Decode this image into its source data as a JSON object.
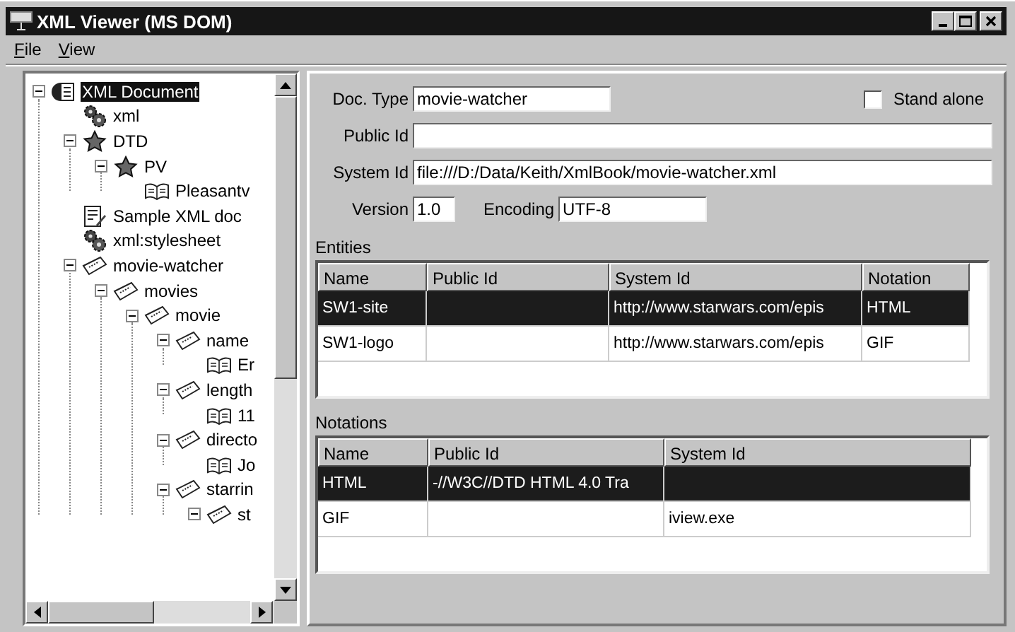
{
  "window": {
    "title": "XML Viewer (MS DOM)"
  },
  "menu": [
    {
      "label": "File"
    },
    {
      "label": "View"
    }
  ],
  "tree": [
    {
      "label": "XML Document",
      "kind": "document",
      "expanded": true,
      "selected": true,
      "children": [
        {
          "label": "xml",
          "kind": "instruction",
          "selected": false
        },
        {
          "label": "DTD",
          "kind": "declaration",
          "expanded": true,
          "selected": false,
          "children": [
            {
              "label": "PV",
              "kind": "declaration",
              "expanded": true,
              "selected": false,
              "children": [
                {
                  "label": "Pleasantv",
                  "kind": "text",
                  "selected": false
                }
              ]
            }
          ]
        },
        {
          "label": "Sample XML doc",
          "kind": "comment",
          "selected": false
        },
        {
          "label": "xml:stylesheet",
          "kind": "instruction",
          "selected": false
        },
        {
          "label": "movie-watcher",
          "kind": "element",
          "expanded": true,
          "selected": false,
          "children": [
            {
              "label": "movies",
              "kind": "element",
              "expanded": true,
              "selected": false,
              "children": [
                {
                  "label": "movie",
                  "kind": "element",
                  "expanded": true,
                  "selected": false,
                  "children": [
                    {
                      "label": "name",
                      "kind": "element",
                      "expanded": true,
                      "selected": false,
                      "children": [
                        {
                          "label": "Er",
                          "kind": "text",
                          "selected": false
                        }
                      ]
                    },
                    {
                      "label": "length",
                      "kind": "element",
                      "expanded": true,
                      "selected": false,
                      "children": [
                        {
                          "label": "11",
                          "kind": "text",
                          "selected": false
                        }
                      ]
                    },
                    {
                      "label": "directo",
                      "kind": "element",
                      "expanded": true,
                      "selected": false,
                      "children": [
                        {
                          "label": "Jo",
                          "kind": "text",
                          "selected": false
                        }
                      ]
                    },
                    {
                      "label": "starrin",
                      "kind": "element",
                      "expanded": true,
                      "selected": false,
                      "children": [
                        {
                          "label": "st",
                          "kind": "element",
                          "expanded": true,
                          "selected": false
                        }
                      ]
                    }
                  ]
                }
              ]
            }
          ]
        }
      ]
    }
  ],
  "document": {
    "doc_type": {
      "label": "Doc. Type",
      "value": "movie-watcher"
    },
    "standalone": {
      "label": "Stand alone",
      "checked": false
    },
    "public_id": {
      "label": "Public Id"
    },
    "system_id": {
      "label": "System Id",
      "value": "file:///D:/Data/Keith/XmlBook/movie-watcher.xml"
    },
    "version": {
      "label": "Version",
      "value": "1.0"
    },
    "encoding": {
      "label": "Encoding",
      "value": "UTF-8"
    }
  },
  "entities": {
    "label": "Entities",
    "columns": [
      "Name",
      "Public Id",
      "System Id",
      "Notation"
    ],
    "rows": [
      {
        "cells": [
          "SW1-site",
          null,
          "http://www.starwars.com/epis",
          "HTML"
        ],
        "selected": true
      },
      {
        "cells": [
          "SW1-logo",
          null,
          "http://www.starwars.com/epis",
          "GIF"
        ],
        "selected": false
      }
    ]
  },
  "notations": {
    "label": "Notations",
    "columns": [
      "Name",
      "Public Id",
      "System Id"
    ],
    "rows": [
      {
        "cells": [
          "HTML",
          "-//W3C//DTD HTML 4.0 Tra",
          null
        ],
        "selected": true
      },
      {
        "cells": [
          "GIF",
          null,
          "iview.exe"
        ],
        "selected": false
      }
    ]
  }
}
